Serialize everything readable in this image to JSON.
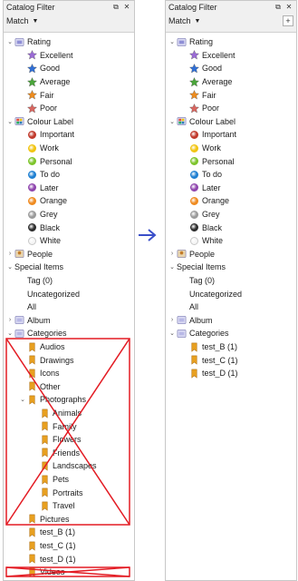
{
  "title": "Catalog Filter",
  "match_label": "Match",
  "add_label": "+",
  "colors": {
    "excellent": "#9b6bd6",
    "good": "#2f6fd6",
    "average": "#4aa63a",
    "fair": "#ee8c1e",
    "poor": "#d9655f",
    "important": "#c0392b",
    "work": "#f1c40f",
    "personal": "#7cc42a",
    "todo": "#1e7fd1",
    "later": "#8e44ad",
    "orange": "#ef8a1f",
    "grey": "#9a9a9a",
    "black": "#2c2c2c",
    "white": "#f4f4f4",
    "annotation": "#e31b23",
    "arrow": "#3a4fc9"
  },
  "left": {
    "rows": [
      {
        "label": "Rating",
        "indent": 0,
        "exp": "v",
        "icon": "rating-icon"
      },
      {
        "label": "Excellent",
        "indent": 1,
        "exp": "",
        "icon": "star",
        "color": "excellent"
      },
      {
        "label": "Good",
        "indent": 1,
        "exp": "",
        "icon": "star",
        "color": "good"
      },
      {
        "label": "Average",
        "indent": 1,
        "exp": "",
        "icon": "star",
        "color": "average"
      },
      {
        "label": "Fair",
        "indent": 1,
        "exp": "",
        "icon": "star",
        "color": "fair"
      },
      {
        "label": "Poor",
        "indent": 1,
        "exp": "",
        "icon": "star",
        "color": "poor"
      },
      {
        "label": "Colour Label",
        "indent": 0,
        "exp": "v",
        "icon": "colour-label-icon"
      },
      {
        "label": "Important",
        "indent": 1,
        "exp": "",
        "icon": "dot",
        "color": "important"
      },
      {
        "label": "Work",
        "indent": 1,
        "exp": "",
        "icon": "dot",
        "color": "work"
      },
      {
        "label": "Personal",
        "indent": 1,
        "exp": "",
        "icon": "dot",
        "color": "personal"
      },
      {
        "label": "To do",
        "indent": 1,
        "exp": "",
        "icon": "dot",
        "color": "todo"
      },
      {
        "label": "Later",
        "indent": 1,
        "exp": "",
        "icon": "dot",
        "color": "later"
      },
      {
        "label": "Orange",
        "indent": 1,
        "exp": "",
        "icon": "dot",
        "color": "orange"
      },
      {
        "label": "Grey",
        "indent": 1,
        "exp": "",
        "icon": "dot",
        "color": "grey"
      },
      {
        "label": "Black",
        "indent": 1,
        "exp": "",
        "icon": "dot",
        "color": "black"
      },
      {
        "label": "White",
        "indent": 1,
        "exp": "",
        "icon": "dot",
        "color": "white"
      },
      {
        "label": "People",
        "indent": 0,
        "exp": ">",
        "icon": "people-icon"
      },
      {
        "label": "Special Items",
        "indent": 0,
        "exp": "v",
        "icon": ""
      },
      {
        "label": "Tag (0)",
        "indent": 1,
        "exp": "",
        "icon": ""
      },
      {
        "label": "Uncategorized",
        "indent": 1,
        "exp": "",
        "icon": ""
      },
      {
        "label": "All",
        "indent": 1,
        "exp": "",
        "icon": ""
      },
      {
        "label": "Album",
        "indent": 0,
        "exp": ">",
        "icon": "album-icon"
      },
      {
        "label": "Categories",
        "indent": 0,
        "exp": "v",
        "icon": "categories-icon"
      },
      {
        "label": "Audios",
        "indent": 1,
        "exp": "",
        "icon": "bookmark"
      },
      {
        "label": "Drawings",
        "indent": 1,
        "exp": "",
        "icon": "bookmark"
      },
      {
        "label": "Icons",
        "indent": 1,
        "exp": "",
        "icon": "bookmark"
      },
      {
        "label": "Other",
        "indent": 1,
        "exp": "",
        "icon": "bookmark"
      },
      {
        "label": "Photographs",
        "indent": 1,
        "exp": "v",
        "icon": "bookmark"
      },
      {
        "label": "Animals",
        "indent": 2,
        "exp": "",
        "icon": "bookmark"
      },
      {
        "label": "Family",
        "indent": 2,
        "exp": "",
        "icon": "bookmark"
      },
      {
        "label": "Flowers",
        "indent": 2,
        "exp": "",
        "icon": "bookmark"
      },
      {
        "label": "Friends",
        "indent": 2,
        "exp": "",
        "icon": "bookmark"
      },
      {
        "label": "Landscapes",
        "indent": 2,
        "exp": "",
        "icon": "bookmark"
      },
      {
        "label": "Pets",
        "indent": 2,
        "exp": "",
        "icon": "bookmark"
      },
      {
        "label": "Portraits",
        "indent": 2,
        "exp": "",
        "icon": "bookmark"
      },
      {
        "label": "Travel",
        "indent": 2,
        "exp": "",
        "icon": "bookmark"
      },
      {
        "label": "Pictures",
        "indent": 1,
        "exp": "",
        "icon": "bookmark"
      },
      {
        "label": "test_B (1)",
        "indent": 1,
        "exp": "",
        "icon": "bookmark"
      },
      {
        "label": "test_C (1)",
        "indent": 1,
        "exp": "",
        "icon": "bookmark"
      },
      {
        "label": "test_D (1)",
        "indent": 1,
        "exp": "",
        "icon": "bookmark"
      },
      {
        "label": "Videos",
        "indent": 1,
        "exp": "",
        "icon": "bookmark"
      }
    ]
  },
  "right": {
    "rows": [
      {
        "label": "Rating",
        "indent": 0,
        "exp": "v",
        "icon": "rating-icon"
      },
      {
        "label": "Excellent",
        "indent": 1,
        "exp": "",
        "icon": "star",
        "color": "excellent"
      },
      {
        "label": "Good",
        "indent": 1,
        "exp": "",
        "icon": "star",
        "color": "good"
      },
      {
        "label": "Average",
        "indent": 1,
        "exp": "",
        "icon": "star",
        "color": "average"
      },
      {
        "label": "Fair",
        "indent": 1,
        "exp": "",
        "icon": "star",
        "color": "fair"
      },
      {
        "label": "Poor",
        "indent": 1,
        "exp": "",
        "icon": "star",
        "color": "poor"
      },
      {
        "label": "Colour Label",
        "indent": 0,
        "exp": "v",
        "icon": "colour-label-icon"
      },
      {
        "label": "Important",
        "indent": 1,
        "exp": "",
        "icon": "dot",
        "color": "important"
      },
      {
        "label": "Work",
        "indent": 1,
        "exp": "",
        "icon": "dot",
        "color": "work"
      },
      {
        "label": "Personal",
        "indent": 1,
        "exp": "",
        "icon": "dot",
        "color": "personal"
      },
      {
        "label": "To do",
        "indent": 1,
        "exp": "",
        "icon": "dot",
        "color": "todo"
      },
      {
        "label": "Later",
        "indent": 1,
        "exp": "",
        "icon": "dot",
        "color": "later"
      },
      {
        "label": "Orange",
        "indent": 1,
        "exp": "",
        "icon": "dot",
        "color": "orange"
      },
      {
        "label": "Grey",
        "indent": 1,
        "exp": "",
        "icon": "dot",
        "color": "grey"
      },
      {
        "label": "Black",
        "indent": 1,
        "exp": "",
        "icon": "dot",
        "color": "black"
      },
      {
        "label": "White",
        "indent": 1,
        "exp": "",
        "icon": "dot",
        "color": "white"
      },
      {
        "label": "People",
        "indent": 0,
        "exp": ">",
        "icon": "people-icon"
      },
      {
        "label": "Special Items",
        "indent": 0,
        "exp": "v",
        "icon": ""
      },
      {
        "label": "Tag (0)",
        "indent": 1,
        "exp": "",
        "icon": ""
      },
      {
        "label": "Uncategorized",
        "indent": 1,
        "exp": "",
        "icon": ""
      },
      {
        "label": "All",
        "indent": 1,
        "exp": "",
        "icon": ""
      },
      {
        "label": "Album",
        "indent": 0,
        "exp": ">",
        "icon": "album-icon"
      },
      {
        "label": "Categories",
        "indent": 0,
        "exp": "v",
        "icon": "categories-icon"
      },
      {
        "label": "test_B (1)",
        "indent": 1,
        "exp": "",
        "icon": "bookmark"
      },
      {
        "label": "test_C (1)",
        "indent": 1,
        "exp": "",
        "icon": "bookmark"
      },
      {
        "label": "test_D (1)",
        "indent": 1,
        "exp": "",
        "icon": "bookmark"
      }
    ]
  }
}
